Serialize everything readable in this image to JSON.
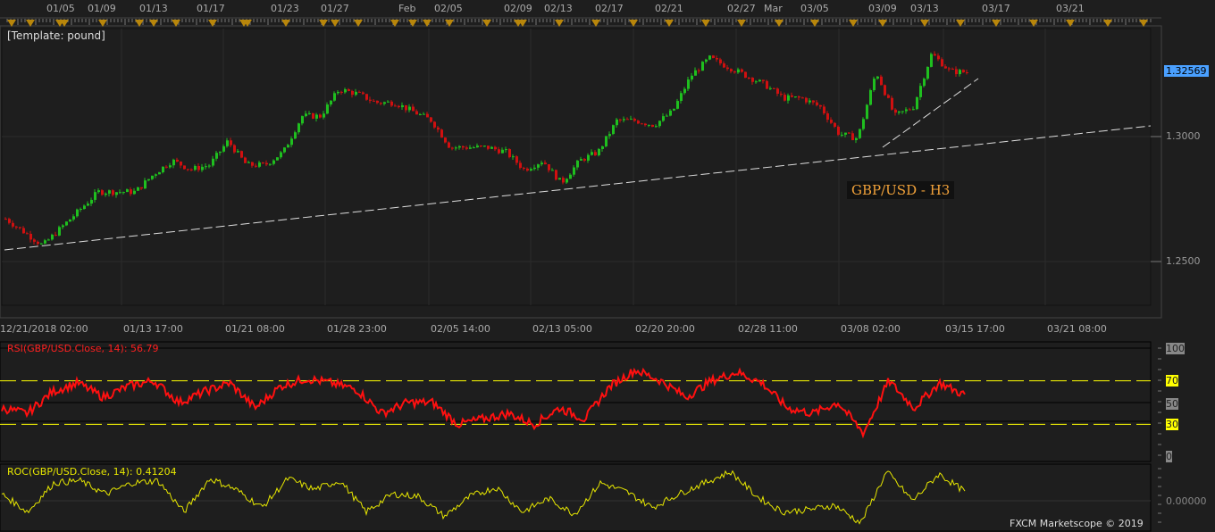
{
  "template_label": "[Template: pound]",
  "instrument_label": "GBP/USD - H3",
  "footer": "FXCM Marketscope © 2019",
  "top_dates": [
    "01/05",
    "01/09",
    "01/13",
    "01/17",
    "01/23",
    "01/27",
    "Feb",
    "02/05",
    "02/09",
    "02/13",
    "02/17",
    "02/21",
    "02/27",
    "Mar",
    "03/05",
    "03/09",
    "03/13",
    "03/17",
    "03/21"
  ],
  "bottom_dates": [
    "12/21/2018 02:00",
    "01/13 17:00",
    "01/21 08:00",
    "01/28 23:00",
    "02/05 14:00",
    "02/13 05:00",
    "02/20 20:00",
    "02/28 11:00",
    "03/08 02:00",
    "03/15 17:00",
    "03/21 08:00"
  ],
  "colors": {
    "up": "#1fbf1f",
    "down": "#d01010",
    "rsi": "#ff1010",
    "roc": "#e8e800",
    "price_tag": "#4aa0ff",
    "level": "#ffff00"
  },
  "chart_data": [
    {
      "type": "candlestick",
      "title": "GBP/USD - H3",
      "price_axis": {
        "ticks": [
          "1.3000",
          "1.2500"
        ],
        "current": "1.32569"
      },
      "ylim": [
        1.23,
        1.34
      ],
      "approx_closes": [
        1.2671,
        1.2618,
        1.2564,
        1.2636,
        1.2707,
        1.2779,
        1.2779,
        1.2779,
        1.285,
        1.2904,
        1.2868,
        1.2886,
        1.2982,
        1.2886,
        1.2886,
        1.2939,
        1.3082,
        1.3082,
        1.3189,
        1.3171,
        1.3136,
        1.3136,
        1.31,
        1.3064,
        1.2957,
        1.2957,
        1.2957,
        1.2939,
        1.2868,
        1.2904,
        1.2814,
        1.2904,
        1.2939,
        1.3064,
        1.3064,
        1.3046,
        1.31,
        1.3243,
        1.3314,
        1.3279,
        1.3243,
        1.3207,
        1.3154,
        1.3154,
        1.3118,
        1.3011,
        1.2993,
        1.3261,
        1.3082,
        1.3118,
        1.3332,
        1.3261,
        1.3257
      ],
      "trendlines": [
        {
          "from": 1.2554,
          "to": 1.304,
          "style": "dashed"
        },
        {
          "from": 1.295,
          "to": 1.3225,
          "style": "dashed"
        }
      ]
    },
    {
      "type": "line",
      "label": "RSI(GBP/USD.Close, 14): 56.79",
      "ylim": [
        0,
        100
      ],
      "ticks": [
        "100",
        "70",
        "50",
        "30",
        "0"
      ],
      "levels": [
        70,
        30
      ],
      "values": [
        45,
        40,
        60,
        68,
        55,
        65,
        70,
        50,
        60,
        68,
        45,
        65,
        72,
        68,
        62,
        40,
        50,
        50,
        30,
        35,
        40,
        30,
        45,
        35,
        65,
        80,
        70,
        55,
        70,
        78,
        68,
        45,
        40,
        50,
        22,
        70,
        45,
        68,
        56.79
      ]
    },
    {
      "type": "line",
      "label": "ROC(GBP/USD.Close, 14): 0.41204",
      "ticks": [
        "0.00000"
      ],
      "values": [
        0.3,
        -0.5,
        0.8,
        0.9,
        0.3,
        0.8,
        0.9,
        -0.5,
        1.0,
        0.5,
        -0.3,
        1.0,
        0.5,
        0.9,
        -0.5,
        0.3,
        0.2,
        -0.7,
        0.2,
        0.6,
        -0.5,
        0.1,
        -0.6,
        0.8,
        0.4,
        -0.3,
        0.3,
        0.8,
        1.3,
        0.2,
        -0.5,
        -0.4,
        -0.2,
        -1.0,
        1.3,
        0.0,
        1.2,
        0.41
      ]
    }
  ]
}
